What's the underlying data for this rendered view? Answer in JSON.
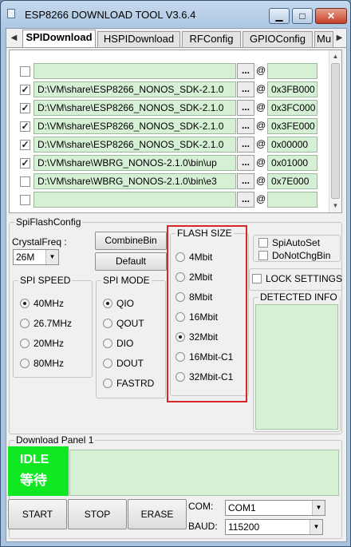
{
  "window": {
    "title": "ESP8266 DOWNLOAD TOOL V3.6.4",
    "min": "▁",
    "max": "□",
    "close": "✕"
  },
  "tabs": [
    "SPIDownload",
    "HSPIDownload",
    "RFConfig",
    "GPIOConfig",
    "Mu"
  ],
  "file_rows": [
    {
      "checked": false,
      "path": "",
      "dots": "...",
      "at": "@",
      "addr": ""
    },
    {
      "checked": true,
      "path": "D:\\VM\\share\\ESP8266_NONOS_SDK-2.1.0",
      "dots": "...",
      "at": "@",
      "addr": "0x3FB000"
    },
    {
      "checked": true,
      "path": "D:\\VM\\share\\ESP8266_NONOS_SDK-2.1.0",
      "dots": "...",
      "at": "@",
      "addr": "0x3FC000"
    },
    {
      "checked": true,
      "path": "D:\\VM\\share\\ESP8266_NONOS_SDK-2.1.0",
      "dots": "...",
      "at": "@",
      "addr": "0x3FE000"
    },
    {
      "checked": true,
      "path": "D:\\VM\\share\\ESP8266_NONOS_SDK-2.1.0",
      "dots": "...",
      "at": "@",
      "addr": "0x00000"
    },
    {
      "checked": true,
      "path": "D:\\VM\\share\\WBRG_NONOS-2.1.0\\bin\\up",
      "dots": "...",
      "at": "@",
      "addr": "0x01000"
    },
    {
      "checked": false,
      "path": "D:\\VM\\share\\WBRG_NONOS-2.1.0\\bin\\e3",
      "dots": "...",
      "at": "@",
      "addr": "0x7E000"
    },
    {
      "checked": false,
      "path": "",
      "dots": "...",
      "at": "@",
      "addr": ""
    }
  ],
  "spiflash": {
    "title": "SpiFlashConfig",
    "crystal_label": "CrystalFreq :",
    "crystal_value": "26M",
    "combine_button": "CombineBin",
    "default_button": "Default",
    "spi_speed": {
      "title": "SPI SPEED",
      "options": [
        "40MHz",
        "26.7MHz",
        "20MHz",
        "80MHz"
      ],
      "selected": "40MHz"
    },
    "spi_mode": {
      "title": "SPI MODE",
      "options": [
        "QIO",
        "QOUT",
        "DIO",
        "DOUT",
        "FASTRD"
      ],
      "selected": "QIO"
    },
    "flash_size": {
      "title": "FLASH SIZE",
      "options": [
        "4Mbit",
        "2Mbit",
        "8Mbit",
        "16Mbit",
        "32Mbit",
        "16Mbit-C1",
        "32Mbit-C1"
      ],
      "selected": "32Mbit"
    },
    "spi_auto_set": "SpiAutoSet",
    "do_not_chg_bin": "DoNotChgBin",
    "lock_settings": "LOCK SETTINGS",
    "detected_info": "DETECTED INFO"
  },
  "download_panel": {
    "title": "Download Panel 1",
    "status_en": "IDLE",
    "status_cn": "等待",
    "start": "START",
    "stop": "STOP",
    "erase": "ERASE",
    "com_label": "COM:",
    "com_value": "COM1",
    "baud_label": "BAUD:",
    "baud_value": "115200"
  },
  "colors": {
    "field_green": "#d6f0d6",
    "idle_green": "#0ee822",
    "highlight_red": "#d8252a"
  }
}
